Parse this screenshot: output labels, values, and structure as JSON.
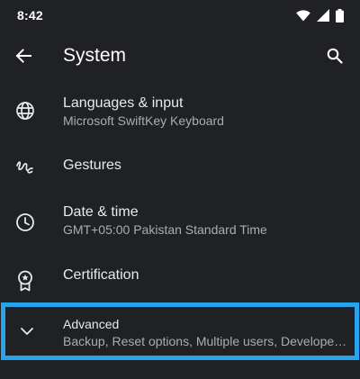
{
  "status_bar": {
    "time": "8:42",
    "icons": [
      "wifi-icon",
      "signal-icon",
      "battery-icon"
    ]
  },
  "app_bar": {
    "title": "System",
    "back_icon": "arrow-back-icon",
    "search_icon": "search-icon"
  },
  "settings": [
    {
      "icon": "globe-icon",
      "title": "Languages & input",
      "summary": "Microsoft SwiftKey Keyboard"
    },
    {
      "icon": "gesture-icon",
      "title": "Gestures",
      "summary": ""
    },
    {
      "icon": "clock-icon",
      "title": "Date & time",
      "summary": "GMT+05:00 Pakistan Standard Time"
    },
    {
      "icon": "certificate-icon",
      "title": "Certification",
      "summary": ""
    },
    {
      "icon": "chevron-down-icon",
      "title": "Advanced",
      "summary": "Backup, Reset options, Multiple users, Developer options"
    }
  ],
  "colors": {
    "background": "#202124",
    "text_primary": "#e8eaed",
    "text_secondary": "#a9adb3",
    "highlight_border": "#29a3ec"
  }
}
